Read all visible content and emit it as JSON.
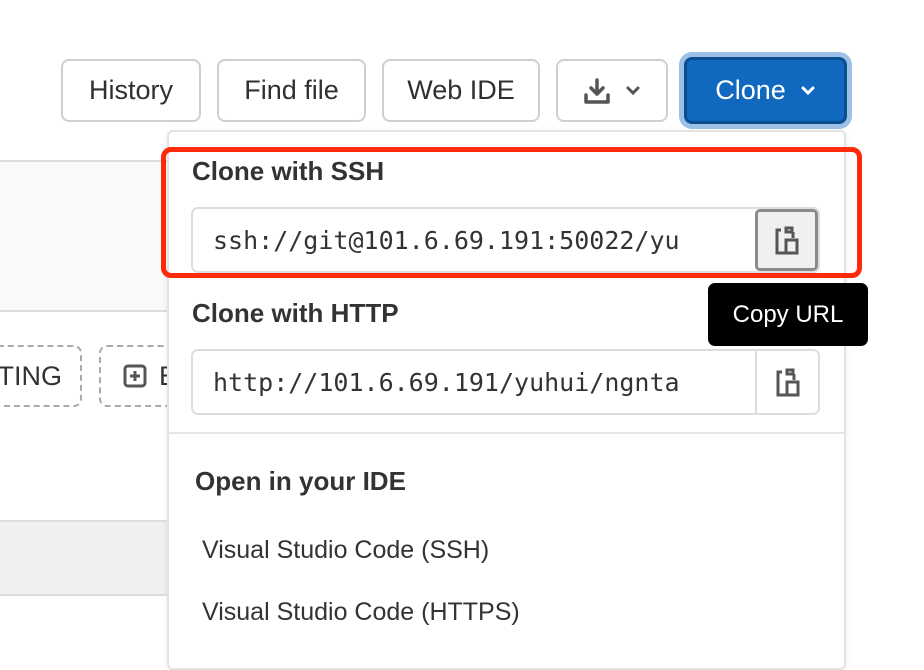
{
  "toolbar": {
    "history": "History",
    "find_file": "Find file",
    "web_ide": "Web IDE",
    "download_icon": "download-icon",
    "clone": "Clone"
  },
  "background": {
    "dashed_button_1": "TING",
    "dashed_button_2": "E"
  },
  "clone_dropdown": {
    "ssh_header": "Clone with SSH",
    "ssh_url": "ssh://git@101.6.69.191:50022/yu",
    "http_header": "Clone with HTTP",
    "http_url": "http://101.6.69.191/yuhui/ngnta",
    "ide_header": "Open in your IDE",
    "ide_items": [
      "Visual Studio Code (SSH)",
      "Visual Studio Code (HTTPS)"
    ]
  },
  "tooltip": "Copy URL",
  "colors": {
    "primary": "#1068bf",
    "highlight": "#ff2a0a"
  }
}
